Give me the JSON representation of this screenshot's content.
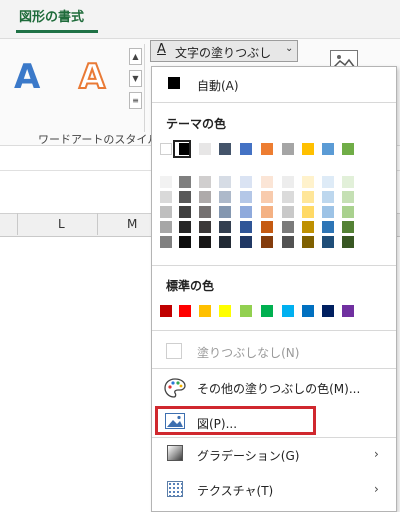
{
  "ribbon": {
    "tab_label": "図形の書式",
    "wordart_group_label": "ワードアートのスタイル",
    "wordart_letters": [
      "A",
      "A"
    ],
    "fill_button": {
      "icon_letter": "A",
      "label": "文字の塗りつぶし",
      "caret": "⌄"
    }
  },
  "sheet": {
    "column_headers": [
      "L",
      "M"
    ]
  },
  "menu": {
    "automatic_label": "自動(A)",
    "theme_colors_title": "テーマの色",
    "theme_top_row": [
      "#ffffff",
      "#000000",
      "#e7e6e6",
      "#44546a",
      "#4472c4",
      "#ed7d31",
      "#a5a5a5",
      "#ffc000",
      "#5b9bd5",
      "#70ad47"
    ],
    "theme_shades": [
      [
        "#f2f2f2",
        "#d9d9d9",
        "#bfbfbf",
        "#a6a6a6",
        "#808080"
      ],
      [
        "#7f7f7f",
        "#595959",
        "#404040",
        "#262626",
        "#0d0d0d"
      ],
      [
        "#d0cece",
        "#aeaaaa",
        "#757171",
        "#3b3838",
        "#181717"
      ],
      [
        "#d6dce5",
        "#adb9ca",
        "#8497b0",
        "#333f50",
        "#222a35"
      ],
      [
        "#dae3f3",
        "#b4c7e7",
        "#8faadc",
        "#2f5597",
        "#203864"
      ],
      [
        "#fbe5d6",
        "#f8cbad",
        "#f4b183",
        "#c55a11",
        "#843c0c"
      ],
      [
        "#ededed",
        "#dbdbdb",
        "#c9c9c9",
        "#7b7b7b",
        "#525252"
      ],
      [
        "#fff2cc",
        "#ffe699",
        "#ffd966",
        "#bf9000",
        "#7f6000"
      ],
      [
        "#deebf7",
        "#bdd7ee",
        "#9dc3e6",
        "#2e75b6",
        "#1f4e79"
      ],
      [
        "#e2f0d9",
        "#c5e0b4",
        "#a9d18e",
        "#548235",
        "#385723"
      ]
    ],
    "standard_colors_title": "標準の色",
    "standard_colors": [
      "#c00000",
      "#ff0000",
      "#ffc000",
      "#ffff00",
      "#92d050",
      "#00b050",
      "#00b0f0",
      "#0070c0",
      "#002060",
      "#7030a0"
    ],
    "no_fill_label": "塗りつぶしなし(N)",
    "more_fill_colors_label": "その他の塗りつぶしの色(M)...",
    "picture_label": "図(P)...",
    "gradient_label": "グラデーション(G)",
    "texture_label": "テクスチャ(T)",
    "submenu_arrow": "›",
    "accent_highlight": "#d0282e"
  }
}
